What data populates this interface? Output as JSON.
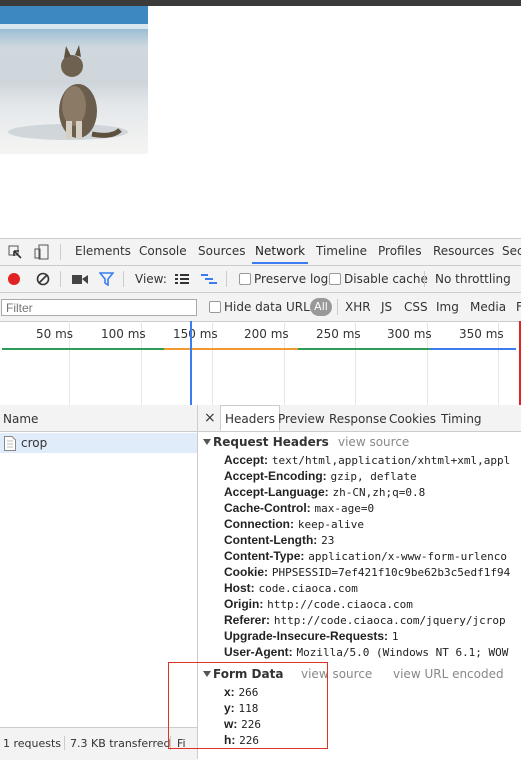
{
  "devtools_tabs": [
    "Elements",
    "Console",
    "Sources",
    "Network",
    "Timeline",
    "Profiles",
    "Resources",
    "Sec"
  ],
  "toolbar": {
    "view_label": "View:",
    "preserve_log": "Preserve log",
    "disable_cache": "Disable cache",
    "throttling": "No throttling"
  },
  "filterbar": {
    "placeholder": "Filter",
    "hide_data_urls": "Hide data URLs",
    "types": [
      "All",
      "XHR",
      "JS",
      "CSS",
      "Img",
      "Media",
      "F"
    ]
  },
  "timeline_ticks": [
    "50 ms",
    "100 ms",
    "150 ms",
    "200 ms",
    "250 ms",
    "300 ms",
    "350 ms"
  ],
  "requests": {
    "column_name": "Name",
    "items": [
      "crop"
    ],
    "status": "1 requests",
    "transferred": "7.3 KB transferred",
    "finish": "Fi"
  },
  "detail": {
    "close": "×",
    "tabs": [
      "Headers",
      "Preview",
      "Response",
      "Cookies",
      "Timing"
    ],
    "request_headers_title": "Request Headers",
    "view_source": "view source",
    "headers": [
      {
        "k": "Accept:",
        "v": "text/html,application/xhtml+xml,appl"
      },
      {
        "k": "Accept-Encoding:",
        "v": "gzip, deflate"
      },
      {
        "k": "Accept-Language:",
        "v": "zh-CN,zh;q=0.8"
      },
      {
        "k": "Cache-Control:",
        "v": "max-age=0"
      },
      {
        "k": "Connection:",
        "v": "keep-alive"
      },
      {
        "k": "Content-Length:",
        "v": "23"
      },
      {
        "k": "Content-Type:",
        "v": "application/x-www-form-urlenco"
      },
      {
        "k": "Cookie:",
        "v": "PHPSESSID=7ef421f10c9be62b3c5edf1f94"
      },
      {
        "k": "Host:",
        "v": "code.ciaoca.com"
      },
      {
        "k": "Origin:",
        "v": "http://code.ciaoca.com"
      },
      {
        "k": "Referer:",
        "v": "http://code.ciaoca.com/jquery/jcrop"
      },
      {
        "k": "Upgrade-Insecure-Requests:",
        "v": "1"
      },
      {
        "k": "User-Agent:",
        "v": "Mozilla/5.0 (Windows NT 6.1; WOW"
      }
    ],
    "form_data_title": "Form Data",
    "view_url_encoded": "view URL encoded",
    "form_data": [
      {
        "k": "x:",
        "v": "266"
      },
      {
        "k": "y:",
        "v": "118"
      },
      {
        "k": "w:",
        "v": "226"
      },
      {
        "k": "h:",
        "v": "226"
      }
    ]
  },
  "colors": {
    "accent": "#3b7df0",
    "highlight_box": "#dd3322",
    "record": "#e22222"
  }
}
